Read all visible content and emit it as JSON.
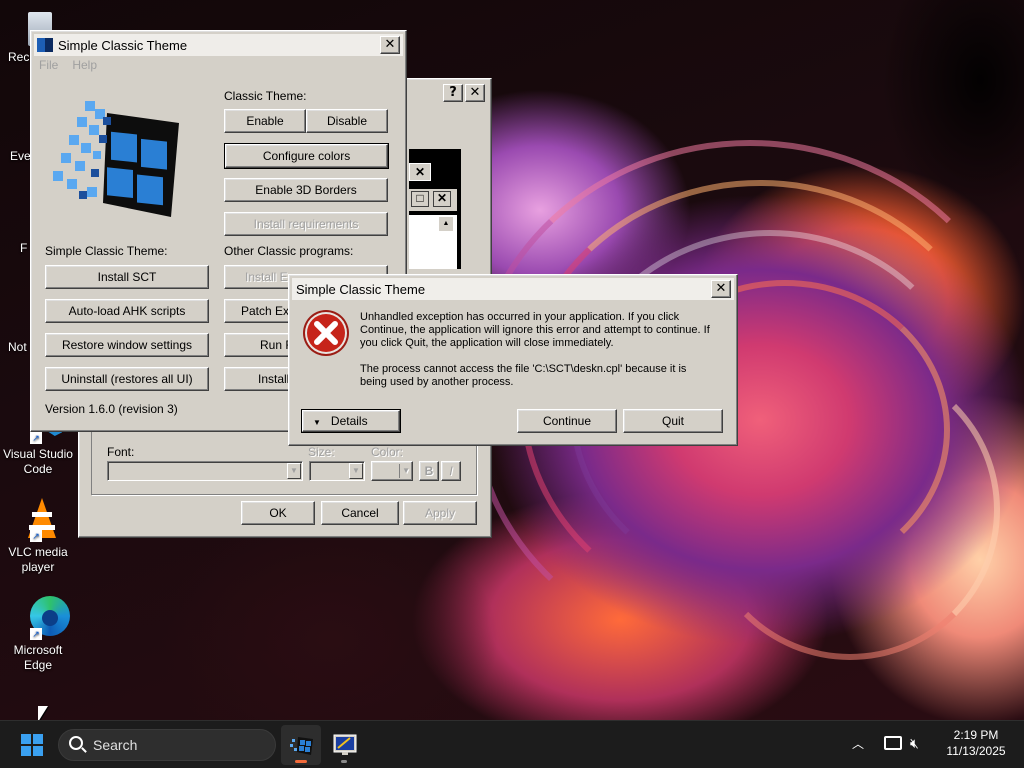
{
  "desktop": {
    "icons": [
      {
        "label": "Rec"
      },
      {
        "label": "Eve"
      },
      {
        "label": "F"
      },
      {
        "label": "Not"
      },
      {
        "label": "Visual Studio Code"
      },
      {
        "label": "VLC media player"
      },
      {
        "label": "Microsoft Edge"
      }
    ]
  },
  "sct_window": {
    "title": "Simple Classic Theme",
    "menu": [
      "File",
      "Help"
    ],
    "classic_theme_label": "Classic Theme:",
    "enable": "Enable",
    "disable": "Disable",
    "configure_colors": "Configure colors",
    "enable_3d_borders": "Enable 3D Borders",
    "install_requirements": "Install requirements",
    "sct_label": "Simple Classic Theme:",
    "install_sct": "Install SCT",
    "autoload_ahk": "Auto-load AHK scripts",
    "restore_window_settings": "Restore window settings",
    "uninstall": "Uninstall (restores all UI)",
    "other_programs_label": "Other Classic programs:",
    "install_ex": "Install E",
    "patch_ex": "Patch Exp",
    "run_r": "Run R",
    "install_c": "Install",
    "version": "Version 1.6.0 (revision 3)"
  },
  "appearance_window": {
    "font_label": "Font:",
    "size_label": "Size:",
    "color_label": "Color:",
    "bold": "B",
    "italic": "I",
    "ok": "OK",
    "cancel": "Cancel",
    "apply": "Apply"
  },
  "error_dialog": {
    "title": "Simple Classic Theme",
    "message1": "Unhandled exception has occurred in your application. If you click Continue, the application will ignore this error and attempt to continue. If you click Quit, the application will close immediately.",
    "message2": "The process cannot access the file 'C:\\SCT\\deskn.cpl' because it is being used by another process.",
    "details": "Details",
    "continue": "Continue",
    "quit": "Quit"
  },
  "taskbar": {
    "search_placeholder": "Search",
    "time": "2:19 PM",
    "date": "11/13/2025",
    "colors": {
      "sct_indicator": "#f26a3a",
      "bg": "#1c1c1c"
    }
  }
}
